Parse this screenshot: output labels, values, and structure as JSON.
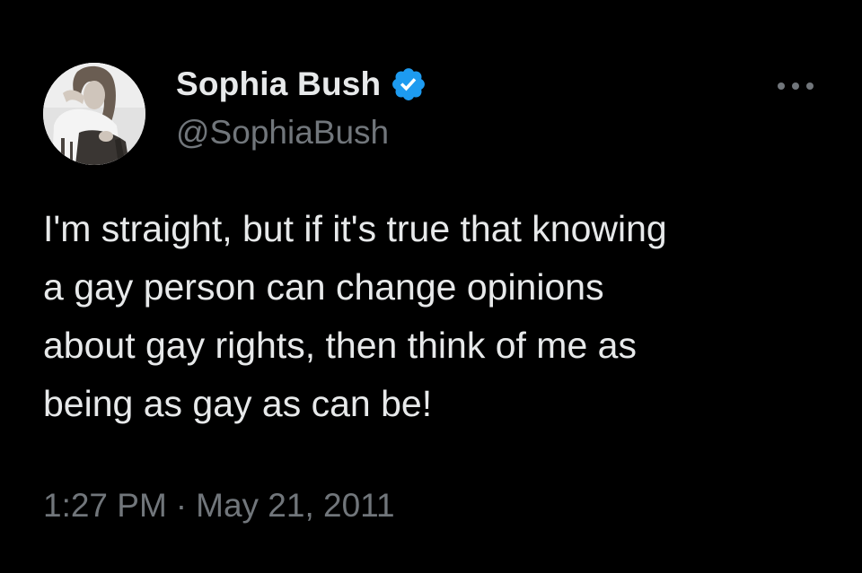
{
  "author": {
    "display_name": "Sophia Bush",
    "handle": "@SophiaBush",
    "verified": true,
    "verified_badge_color": "#1d9bf0",
    "avatar_icon": "profile-photo"
  },
  "tweet": {
    "lines": [
      "I'm straight, but if it's true that knowing",
      "a gay person can change opinions",
      "about gay rights, then think of me as",
      "being as gay as can be!"
    ]
  },
  "meta": {
    "time": "1:27 PM",
    "separator": "·",
    "date": "May 21, 2011"
  },
  "icons": {
    "more": "more-horizontal-icon",
    "verified": "verified-badge-icon"
  },
  "colors": {
    "background": "#000000",
    "primary_text": "#e7e9ea",
    "secondary_text": "#71767b"
  }
}
